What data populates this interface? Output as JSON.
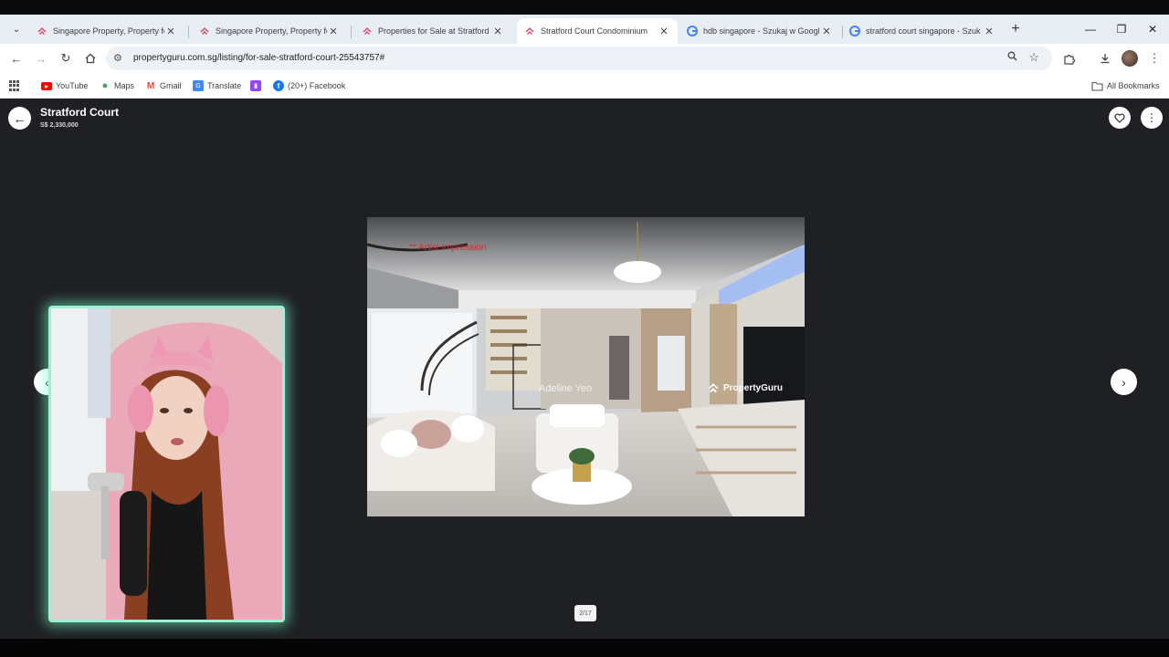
{
  "browser": {
    "tabs": [
      {
        "title": "Singapore Property, Property for",
        "active": false
      },
      {
        "title": "Singapore Property, Property for",
        "active": false
      },
      {
        "title": "Properties for Sale at Stratford",
        "active": false
      },
      {
        "title": "Stratford Court Condominium",
        "active": true
      },
      {
        "title": "hdb singapore - Szukaj w Googl",
        "active": false
      },
      {
        "title": "stratford court singapore - Szuk",
        "active": false
      }
    ],
    "close_glyph": "✕",
    "new_tab_glyph": "+",
    "url": "propertyguru.com.sg/listing/for-sale-stratford-court-25543757#",
    "bookmarks": [
      {
        "label": "YouTube",
        "icon": "youtube-icon",
        "color": "#ff0000"
      },
      {
        "label": "Maps",
        "icon": "maps-pin-icon",
        "color": "#34a853"
      },
      {
        "label": "Gmail",
        "icon": "gmail-icon",
        "color": "#ea4335"
      },
      {
        "label": "Translate",
        "icon": "translate-icon",
        "color": "#4285f4"
      },
      {
        "label": "",
        "icon": "twitch-icon",
        "color": "#9146ff"
      },
      {
        "label": "(20+) Facebook",
        "icon": "facebook-icon",
        "color": "#1877f2"
      }
    ],
    "all_bookmarks_label": "All Bookmarks"
  },
  "listing": {
    "title": "Stratford Court",
    "price": "S$ 2,330,000",
    "photo_counter": "2/17"
  },
  "photo": {
    "caption": "** Artist Impression",
    "agent_watermark": "Adeline Yeo",
    "brand_watermark": "PropertyGuru"
  },
  "colors": {
    "page_background": "#1f2023",
    "caption_red": "#e0242a",
    "webcam_glow": "#9ef2d4"
  }
}
